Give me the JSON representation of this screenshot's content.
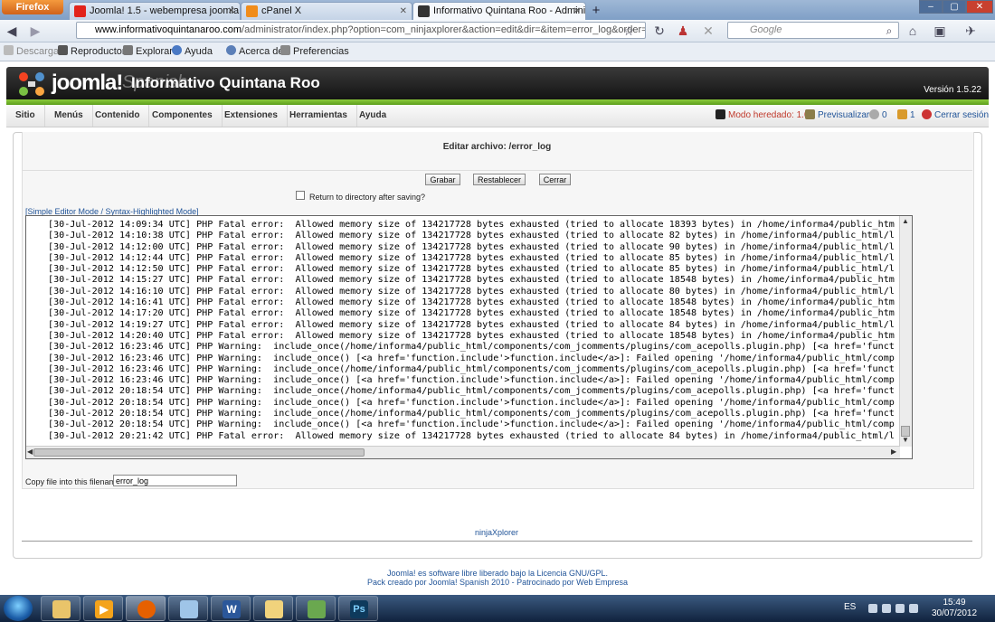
{
  "browser": {
    "app_button": "Firefox",
    "tabs": [
      {
        "title": "Joomla! 1.5 - webempresa joomla - H..."
      },
      {
        "title": "cPanel X"
      },
      {
        "title": "Informativo Quintana Roo - Administ..."
      }
    ],
    "url_domain": "www.informativoquintanaroo.com",
    "url_path": "/administrator/index.php?option=com_ninjaxplorer&action=edit&dir=&item=error_log&order=name&srt=",
    "search_placeholder": "Google",
    "bookmarks": [
      "Descargar",
      "Reproductor",
      "Explorar",
      "Ayuda",
      "Acerca de",
      "Preferencias"
    ]
  },
  "header": {
    "brand": "joomla!",
    "brand_suffix": "Spanish",
    "site_title": "Informativo Quintana Roo",
    "version": "Versión 1.5.22"
  },
  "menu": {
    "items": [
      "Sitio",
      "Menús",
      "Contenido",
      "Componentes",
      "Extensiones",
      "Herramientas",
      "Ayuda"
    ],
    "legacy": "Modo heredado: 1.0",
    "preview": "Previsualizar",
    "messages": "0",
    "users": "1",
    "logout": "Cerrar sesión"
  },
  "editor": {
    "title": "Editar archivo: /error_log",
    "buttons": {
      "save": "Grabar",
      "reset": "Restablecer",
      "close": "Cerrar"
    },
    "checkbox_label": "Return to directory after saving?",
    "mode_link": "[Simple Editor Mode / Syntax-Highlighted Mode]",
    "lines": [
      "[30-Jul-2012 14:09:34 UTC] PHP Fatal error:  Allowed memory size of 134217728 bytes exhausted (tried to allocate 18393 bytes) in /home/informa4/public_htm",
      "[30-Jul-2012 14:10:38 UTC] PHP Fatal error:  Allowed memory size of 134217728 bytes exhausted (tried to allocate 82 bytes) in /home/informa4/public_html/l",
      "[30-Jul-2012 14:12:00 UTC] PHP Fatal error:  Allowed memory size of 134217728 bytes exhausted (tried to allocate 90 bytes) in /home/informa4/public_html/l",
      "[30-Jul-2012 14:12:44 UTC] PHP Fatal error:  Allowed memory size of 134217728 bytes exhausted (tried to allocate 85 bytes) in /home/informa4/public_html/l",
      "[30-Jul-2012 14:12:50 UTC] PHP Fatal error:  Allowed memory size of 134217728 bytes exhausted (tried to allocate 85 bytes) in /home/informa4/public_html/l",
      "[30-Jul-2012 14:15:27 UTC] PHP Fatal error:  Allowed memory size of 134217728 bytes exhausted (tried to allocate 18548 bytes) in /home/informa4/public_htm",
      "[30-Jul-2012 14:16:10 UTC] PHP Fatal error:  Allowed memory size of 134217728 bytes exhausted (tried to allocate 80 bytes) in /home/informa4/public_html/l",
      "[30-Jul-2012 14:16:41 UTC] PHP Fatal error:  Allowed memory size of 134217728 bytes exhausted (tried to allocate 18548 bytes) in /home/informa4/public_htm",
      "[30-Jul-2012 14:17:20 UTC] PHP Fatal error:  Allowed memory size of 134217728 bytes exhausted (tried to allocate 18548 bytes) in /home/informa4/public_htm",
      "[30-Jul-2012 14:19:27 UTC] PHP Fatal error:  Allowed memory size of 134217728 bytes exhausted (tried to allocate 84 bytes) in /home/informa4/public_html/l",
      "[30-Jul-2012 14:20:40 UTC] PHP Fatal error:  Allowed memory size of 134217728 bytes exhausted (tried to allocate 18548 bytes) in /home/informa4/public_htm",
      "[30-Jul-2012 16:23:46 UTC] PHP Warning:  include_once(/home/informa4/public_html/components/com_jcomments/plugins/com_acepolls.plugin.php) [<a href='funct",
      "[30-Jul-2012 16:23:46 UTC] PHP Warning:  include_once() [<a href='function.include'>function.include</a>]: Failed opening '/home/informa4/public_html/comp",
      "[30-Jul-2012 16:23:46 UTC] PHP Warning:  include_once(/home/informa4/public_html/components/com_jcomments/plugins/com_acepolls.plugin.php) [<a href='funct",
      "[30-Jul-2012 16:23:46 UTC] PHP Warning:  include_once() [<a href='function.include'>function.include</a>]: Failed opening '/home/informa4/public_html/comp",
      "[30-Jul-2012 20:18:54 UTC] PHP Warning:  include_once(/home/informa4/public_html/components/com_jcomments/plugins/com_acepolls.plugin.php) [<a href='funct",
      "[30-Jul-2012 20:18:54 UTC] PHP Warning:  include_once() [<a href='function.include'>function.include</a>]: Failed opening '/home/informa4/public_html/comp",
      "[30-Jul-2012 20:18:54 UTC] PHP Warning:  include_once(/home/informa4/public_html/components/com_jcomments/plugins/com_acepolls.plugin.php) [<a href='funct",
      "[30-Jul-2012 20:18:54 UTC] PHP Warning:  include_once() [<a href='function.include'>function.include</a>]: Failed opening '/home/informa4/public_html/comp",
      "[30-Jul-2012 20:21:42 UTC] PHP Fatal error:  Allowed memory size of 134217728 bytes exhausted (tried to allocate 84 bytes) in /home/informa4/public_html/l"
    ],
    "copy_label": "Copy file into this filename",
    "copy_value": "error_log"
  },
  "footer": {
    "ninja": "ninjaXplorer",
    "line1": "Joomla! es software libre liberado bajo la Licencia GNU/GPL.",
    "line2": "Pack creado por Joomla! Spanish 2010 - Patrocinado por Web Empresa"
  },
  "taskbar": {
    "lang": "ES",
    "time": "15:49",
    "date": "30/07/2012",
    "apps": [
      "explorer",
      "media",
      "firefox",
      "folder",
      "word",
      "folder2",
      "network",
      "photoshop"
    ]
  },
  "colors": {
    "joomla_green": "#8ccb3c",
    "link": "#225599",
    "taskbar": "#10223d"
  }
}
